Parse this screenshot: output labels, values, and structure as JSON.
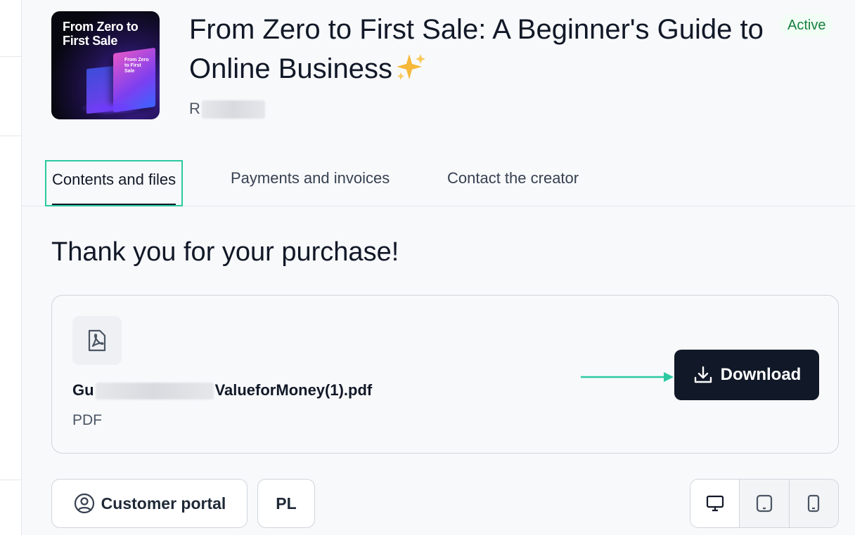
{
  "product": {
    "title": "From Zero to First Sale: A Beginner's Guide to Online Business",
    "title_emoji": "sparkles-icon",
    "status": "Active",
    "creator_visible": "R",
    "cover": {
      "headline": "From Zero to First Sale",
      "book_text": "From Zero to First Sale"
    }
  },
  "tabs": [
    {
      "label": "Contents and files",
      "active": true
    },
    {
      "label": "Payments and invoices",
      "active": false
    },
    {
      "label": "Contact the creator",
      "active": false
    }
  ],
  "main": {
    "heading": "Thank you for your purchase!",
    "file": {
      "name_prefix": "Gu",
      "name_suffix": "ValueforMoney(1).pdf",
      "type": "PDF",
      "icon": "pdf-icon"
    },
    "download_label": "Download"
  },
  "footer": {
    "customer_portal_label": "Customer portal",
    "language_label": "PL",
    "devices": [
      "desktop-icon",
      "tablet-icon",
      "mobile-icon"
    ]
  },
  "colors": {
    "accent": "#2cc9a0",
    "primary_button": "#111827",
    "status_green": "#15803d"
  }
}
